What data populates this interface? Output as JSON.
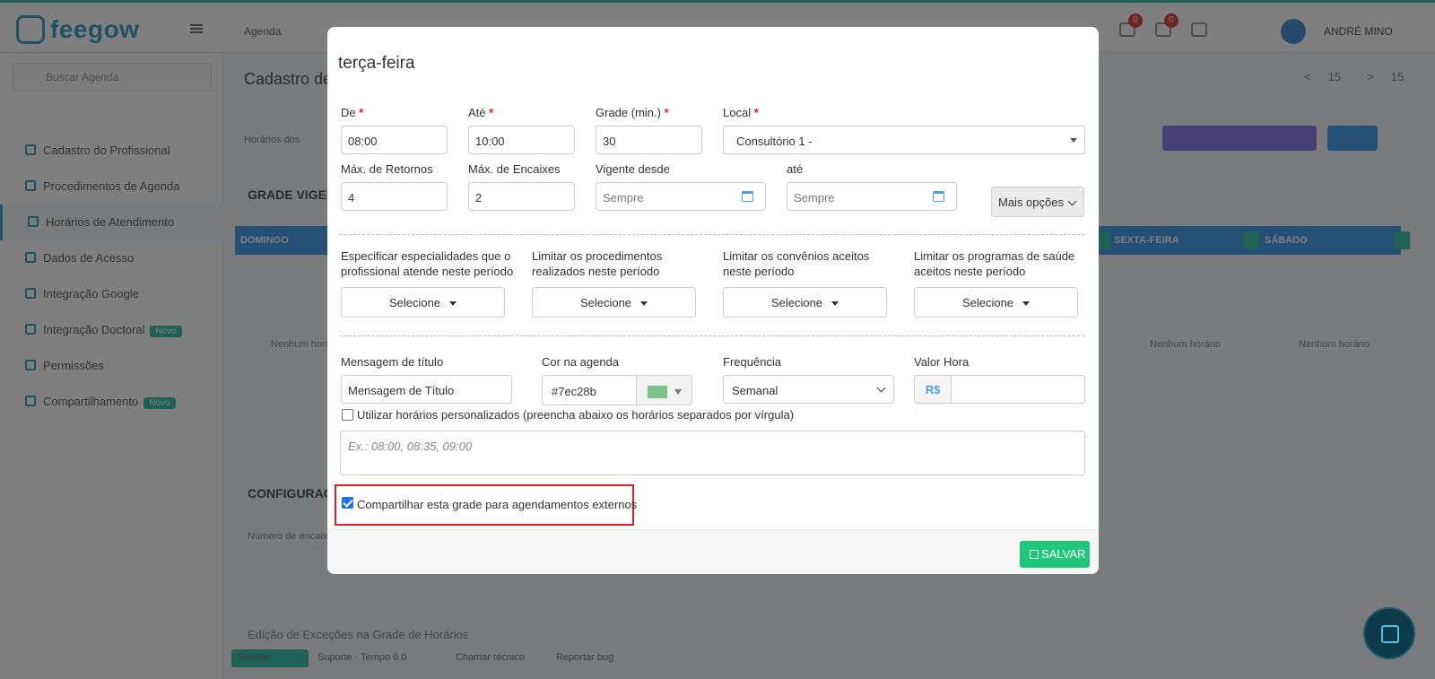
{
  "background": {
    "brand": "feegow",
    "agenda_menu": "Agenda",
    "user_name": "ANDRÉ MINO",
    "notif_badges": [
      "0",
      "0"
    ],
    "search_placeholder": "Buscar Agenda",
    "sidebar_items": [
      {
        "label": "Cadastro do Profissional",
        "badge": ""
      },
      {
        "label": "Procedimentos de Agenda",
        "badge": ""
      },
      {
        "label": "Horários de Atendimento",
        "badge": ""
      },
      {
        "label": "Dados de Acesso",
        "badge": ""
      },
      {
        "label": "Integração Google",
        "badge": ""
      },
      {
        "label": "Integração Doctoral",
        "badge": "Novo"
      },
      {
        "label": "Permissões",
        "badge": ""
      },
      {
        "label": "Compartilhamento",
        "badge": "Novo"
      }
    ],
    "page_title": "Cadastro de Profissional",
    "page_nav": [
      "<",
      "15",
      ">",
      "15"
    ],
    "horarios_label": "Horários dos",
    "grade_title": "GRADE VIGENTE",
    "config_title": "CONFIGURAÇÕES",
    "config_sub": "Número de encaixes",
    "exception_title": "Edição de Exceções na Grade de Horários",
    "days": [
      "DOMINGO",
      "SEXTA-FEIRA",
      "SÁBADO"
    ],
    "no_hours_text": "Nenhum horário",
    "footer_items": [
      "Fechar",
      "Suporte · Tempo 0.0",
      "Chamar técnico",
      "Reportar bug"
    ]
  },
  "modal": {
    "title": "terça-feira",
    "de": {
      "label": "De",
      "value": "08:00"
    },
    "ate": {
      "label": "Até",
      "value": "10:00"
    },
    "grade": {
      "label": "Grade (min.)",
      "value": "30"
    },
    "local": {
      "label": "Local",
      "value": "Consultório 1 -"
    },
    "max_retornos": {
      "label": "Máx. de Retornos",
      "value": "4"
    },
    "max_encaixes": {
      "label": "Máx. de Encaixes",
      "value": "2"
    },
    "vigente_desde": {
      "label": "Vigente desde",
      "placeholder": "Sempre"
    },
    "vigente_ate": {
      "label": "até",
      "placeholder": "Sempre"
    },
    "mais_opcoes": "Mais opções",
    "filters": [
      {
        "label_line1": "Especificar especialidades que o",
        "label_line2": "profissional atende neste período",
        "button": "Selecione"
      },
      {
        "label_line1": "Limitar os procedimentos",
        "label_line2": "realizados neste período",
        "button": "Selecione"
      },
      {
        "label_line1": "Limitar os convênios aceitos",
        "label_line2": "neste período",
        "button": "Selecione"
      },
      {
        "label_line1": "Limitar os programas de saúde",
        "label_line2": "aceitos neste período",
        "button": "Selecione"
      }
    ],
    "mensagem": {
      "label": "Mensagem de título",
      "value": "Mensagem de Título"
    },
    "cor": {
      "label": "Cor na agenda",
      "value": "#7ec28b",
      "swatch_color": "#7ec28b"
    },
    "frequencia": {
      "label": "Frequência",
      "value": "Semanal"
    },
    "valor_hora": {
      "label": "Valor Hora",
      "prefix": "R$",
      "value": ""
    },
    "personalizados_label": "Utilizar horários personalizados (preencha abaixo os horários separados por vírgula)",
    "personalizados_checked": false,
    "personalizados_placeholder": "Ex.: 08:00, 08:35, 09:00",
    "compartilhar_label": "Compartilhar esta grade para agendamentos externos",
    "compartilhar_checked": true,
    "save_label": "SALVAR"
  },
  "colors": {
    "accent_blue": "#4a9ee8",
    "success_green": "#1fc77a",
    "required_red": "#e02020",
    "highlight_red": "#e02020"
  }
}
